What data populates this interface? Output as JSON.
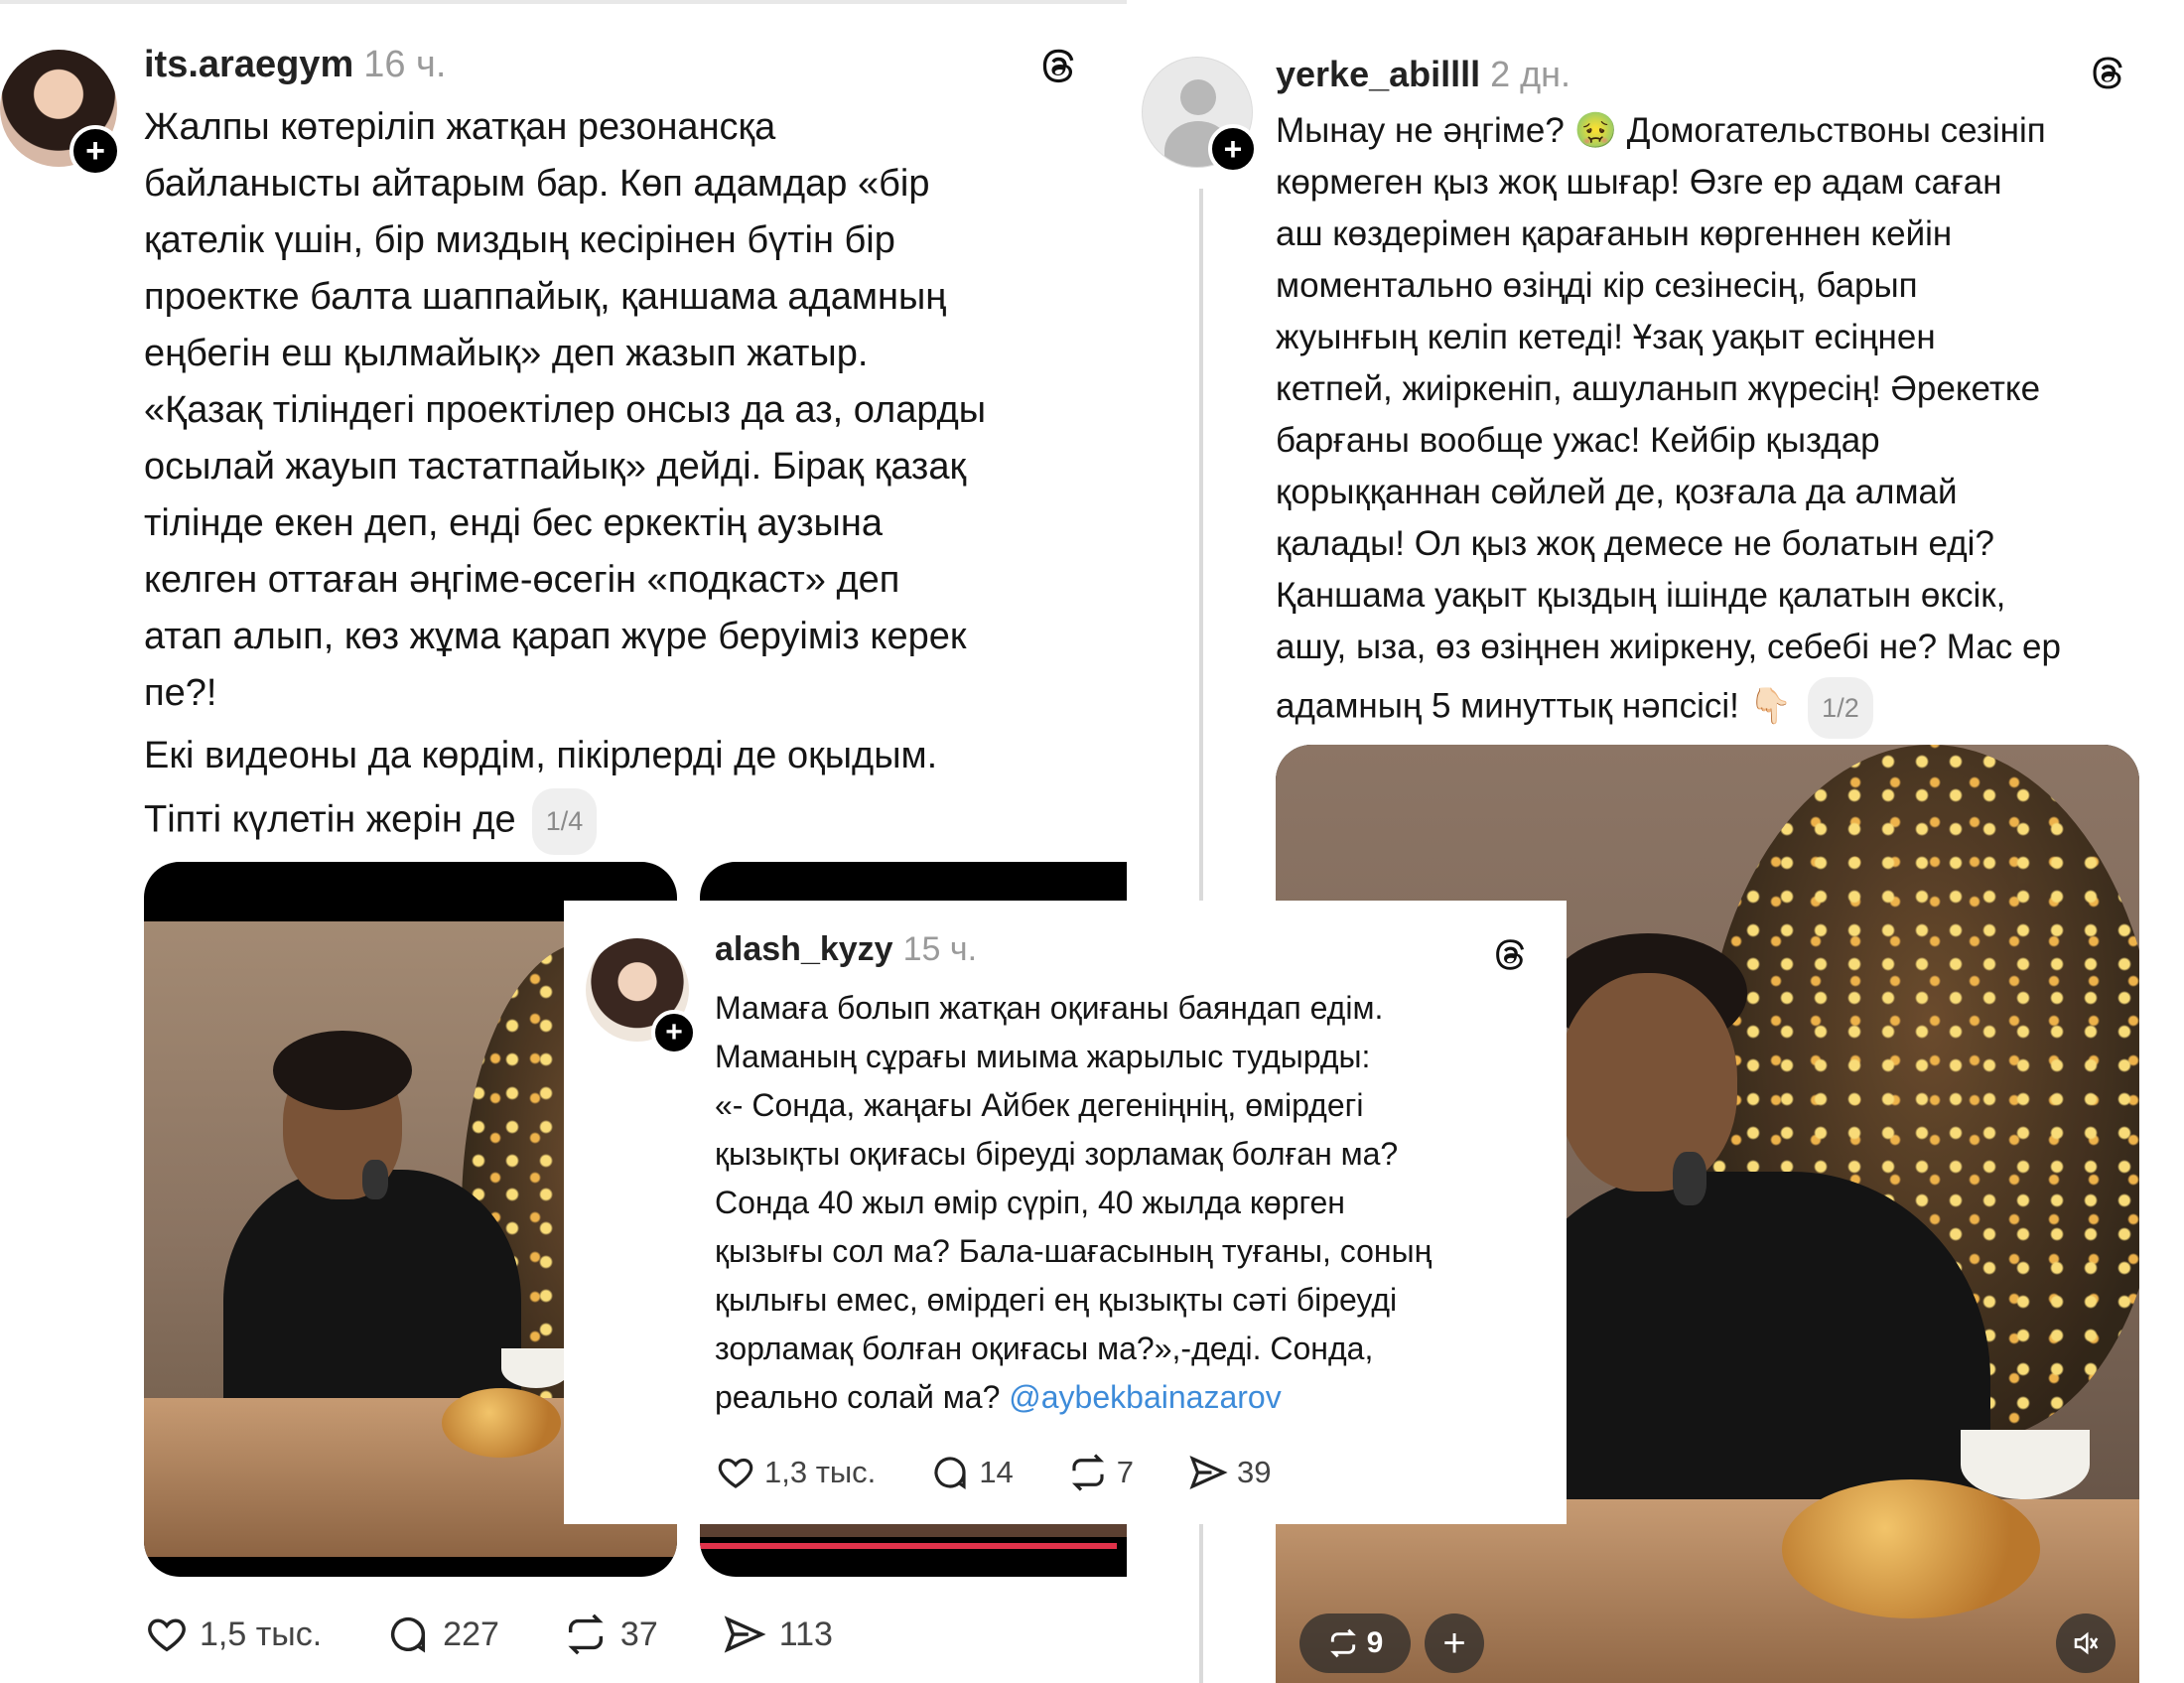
{
  "post_left": {
    "username": "its.araegym",
    "time": "16 ч.",
    "lines": [
      "Жалпы көтеріліп жатқан резонансқа",
      "байланысты айтарым бар. Көп адамдар «бір",
      "қателік үшін, бір миздың кесірінен бүтін бір",
      "проектке балта шаппайық, қаншама адамның",
      "еңбегін еш қылмайық» деп жазып жатыр.",
      "«Қазақ тіліндегі проектілер онсыз да аз, оларды",
      "осылай жауып тастатпайық» дейді. Бірақ қазақ",
      "тілінде екен деп, енді бес еркектің аузына",
      "келген оттаған әңгіме-өсегін «подкаст» деп",
      "атап алып, көз жұма қарап жүре беруіміз керек",
      "пе?!"
    ],
    "line2": "Екі видеоны да көрдім, пікірлерді де оқыдым.",
    "line3": "Тіпті күлетін жерін де",
    "counter": "1/4",
    "likes": "1,5 тыс.",
    "comments": "227",
    "reposts": "37",
    "shares": "113"
  },
  "post_right": {
    "username": "yerke_abillll",
    "time": "2 дн.",
    "lines": [
      "Мынау не әңгіме? 🤢 Домогательствоны сезініп",
      "көрмеген қыз жоқ шығар! Өзге ер адам саған",
      "аш көздерімен қарағанын көргеннен кейін",
      "моментально өзіңді кір сезінесің, барып",
      "жуынғың келіп кетеді! Ұзақ уақыт есіңнен",
      "кетпей, жиіркеніп, ашуланып жүресің! Әрекетке",
      "барғаны вообще ужас! Кейбір қыздар",
      "қорыққаннан сөйлей де, қозғала да алмай",
      "қалады! Ол қыз жоқ демесе не болатын еді?",
      "Қаншама уақыт қыздың ішінде қалатын өксік,",
      "ашу, ыза, өз өзіңнен жиіркену, себебі не? Мас ер"
    ],
    "last_line": "адамның 5 минуттық нәпсісі! 👇🏻",
    "counter": "1/2",
    "media_reposts": "9"
  },
  "post_overlay": {
    "username": "alash_kyzy",
    "time": "15 ч.",
    "lines": [
      "Мамаға болып жатқан оқиғаны баяндап едім.",
      "Маманың сұрағы миыма жарылыс тудырды:",
      "«- Сонда, жаңағы Айбек дегеніңнің, өмірдегі",
      "қызықты оқиғасы біреуді зорламақ болған ма?",
      "Сонда 40 жыл өмір сүріп, 40 жылда көрген",
      "қызығы сол ма? Бала-шағасының туғаны, соның",
      "қылығы емес, өмірдегі ең қызықты сәті біреуді",
      "зорламақ болған оқиғасы ма?»,-деді. Сонда,"
    ],
    "last_line_prefix": "реально солай ма?",
    "mention": "@aybekbainazarov",
    "likes": "1,3 тыс.",
    "comments": "14",
    "reposts": "7",
    "shares": "39"
  },
  "colors": {
    "mention": "#3d8bd9",
    "muted": "#9a9a9a",
    "badge_bg": "#000000"
  }
}
